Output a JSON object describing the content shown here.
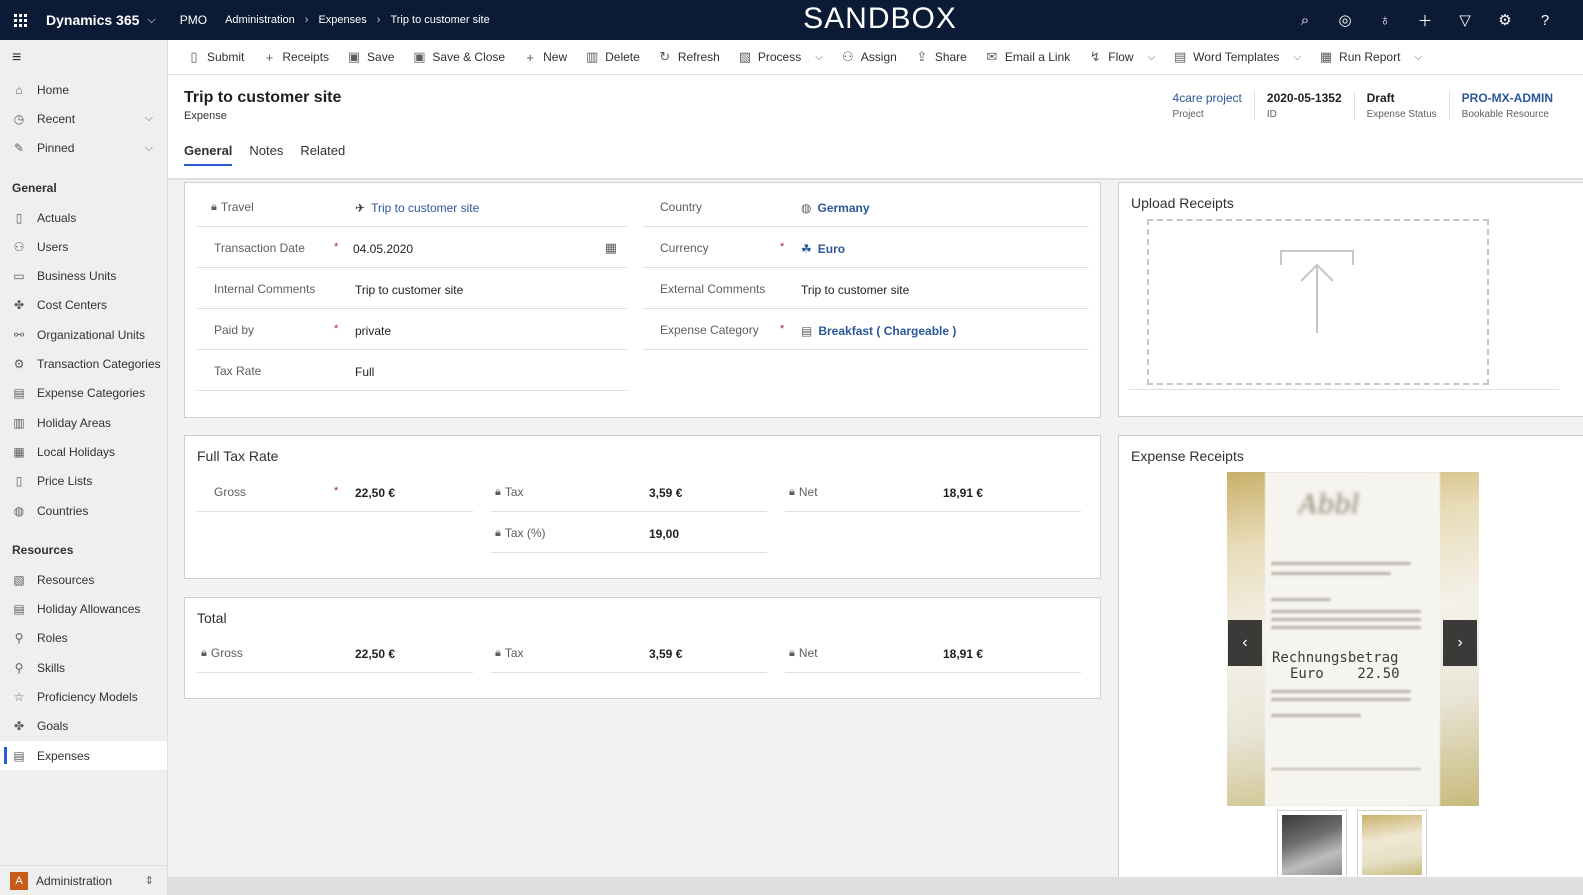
{
  "topbar": {
    "app_name": "Dynamics 365",
    "area": "PMO",
    "breadcrumbs": [
      "Administration",
      "Expenses",
      "Trip to customer site"
    ],
    "environment_banner": "SANDBOX",
    "icons": [
      "search-icon",
      "task-icon",
      "lightbulb-icon",
      "plus-icon",
      "filter-icon",
      "gear-icon",
      "help-icon"
    ]
  },
  "commands": [
    {
      "label": "Submit",
      "icon": "doc-icon",
      "dropdown": false
    },
    {
      "label": "Receipts",
      "icon": "plus-icon",
      "dropdown": false
    },
    {
      "label": "Save",
      "icon": "save-icon",
      "dropdown": false
    },
    {
      "label": "Save & Close",
      "icon": "save-close-icon",
      "dropdown": false
    },
    {
      "label": "New",
      "icon": "plus-icon",
      "dropdown": false
    },
    {
      "label": "Delete",
      "icon": "trash-icon",
      "dropdown": false
    },
    {
      "label": "Refresh",
      "icon": "refresh-icon",
      "dropdown": false
    },
    {
      "label": "Process",
      "icon": "process-icon",
      "dropdown": true
    },
    {
      "label": "Assign",
      "icon": "person-icon",
      "dropdown": false
    },
    {
      "label": "Share",
      "icon": "share-icon",
      "dropdown": false
    },
    {
      "label": "Email a Link",
      "icon": "mail-icon",
      "dropdown": false
    },
    {
      "label": "Flow",
      "icon": "flow-icon",
      "dropdown": true
    },
    {
      "label": "Word Templates",
      "icon": "word-icon",
      "dropdown": true
    },
    {
      "label": "Run Report",
      "icon": "report-icon",
      "dropdown": true
    }
  ],
  "sidebar": {
    "top": [
      {
        "label": "Home",
        "icon": "home-icon",
        "expand": false
      },
      {
        "label": "Recent",
        "icon": "clock-icon",
        "expand": true
      },
      {
        "label": "Pinned",
        "icon": "pin-icon",
        "expand": true
      }
    ],
    "sections": [
      {
        "title": "General",
        "items": [
          {
            "label": "Actuals",
            "icon": "doc-icon"
          },
          {
            "label": "Users",
            "icon": "person-icon"
          },
          {
            "label": "Business Units",
            "icon": "building-icon"
          },
          {
            "label": "Cost Centers",
            "icon": "puzzle-icon"
          },
          {
            "label": "Organizational Units",
            "icon": "org-icon"
          },
          {
            "label": "Transaction Categories",
            "icon": "gear-icon"
          },
          {
            "label": "Expense Categories",
            "icon": "category-icon"
          },
          {
            "label": "Holiday Areas",
            "icon": "map-icon"
          },
          {
            "label": "Local Holidays",
            "icon": "calendar-icon"
          },
          {
            "label": "Price Lists",
            "icon": "pricelist-icon"
          },
          {
            "label": "Countries",
            "icon": "globe-icon"
          }
        ]
      },
      {
        "title": "Resources",
        "items": [
          {
            "label": "Resources",
            "icon": "resource-icon"
          },
          {
            "label": "Holiday Allowances",
            "icon": "allowance-icon"
          },
          {
            "label": "Roles",
            "icon": "role-icon"
          },
          {
            "label": "Skills",
            "icon": "skill-icon"
          },
          {
            "label": "Proficiency Models",
            "icon": "star-icon"
          },
          {
            "label": "Goals",
            "icon": "puzzle-icon"
          },
          {
            "label": "Expenses",
            "icon": "expense-icon",
            "active": true
          }
        ]
      }
    ],
    "area_switcher": {
      "initial": "A",
      "label": "Administration"
    }
  },
  "header": {
    "title": "Trip to customer site",
    "entity": "Expense",
    "fields": [
      {
        "value": "4care project",
        "label": "Project",
        "style": "link"
      },
      {
        "value": "2020-05-1352",
        "label": "ID",
        "style": "bold"
      },
      {
        "value": "Draft",
        "label": "Expense Status",
        "style": "bold"
      },
      {
        "value": "PRO-MX-ADMIN",
        "label": "Bookable Resource",
        "style": "linkbold"
      }
    ],
    "tabs": [
      "General",
      "Notes",
      "Related"
    ],
    "active_tab": "General"
  },
  "general": {
    "travel": {
      "label": "Travel",
      "value": "Trip to customer site"
    },
    "transaction_date": {
      "label": "Transaction Date",
      "value": "04.05.2020"
    },
    "internal_comments": {
      "label": "Internal Comments",
      "value": "Trip to customer site"
    },
    "paid_by": {
      "label": "Paid by",
      "value": "private"
    },
    "tax_rate": {
      "label": "Tax Rate",
      "value": "Full"
    },
    "country": {
      "label": "Country",
      "value": "Germany"
    },
    "currency": {
      "label": "Currency",
      "value": "Euro"
    },
    "external_comments": {
      "label": "External Comments",
      "value": "Trip to customer site"
    },
    "expense_category": {
      "label": "Expense Category",
      "value": "Breakfast ( Chargeable )"
    }
  },
  "full_tax": {
    "title": "Full Tax Rate",
    "gross": {
      "label": "Gross",
      "value": "22,50 €"
    },
    "tax": {
      "label": "Tax",
      "value": "3,59 €"
    },
    "tax_pct": {
      "label": "Tax (%)",
      "value": "19,00"
    },
    "net": {
      "label": "Net",
      "value": "18,91 €"
    }
  },
  "total": {
    "title": "Total",
    "gross": {
      "label": "Gross",
      "value": "22,50 €"
    },
    "tax": {
      "label": "Tax",
      "value": "3,59 €"
    },
    "net": {
      "label": "Net",
      "value": "18,91 €"
    }
  },
  "upload": {
    "title": "Upload Receipts"
  },
  "receipts": {
    "title": "Expense Receipts",
    "receipt_text_1": "Rechnungsbetrag",
    "receipt_text_2": "Euro    22.50"
  }
}
